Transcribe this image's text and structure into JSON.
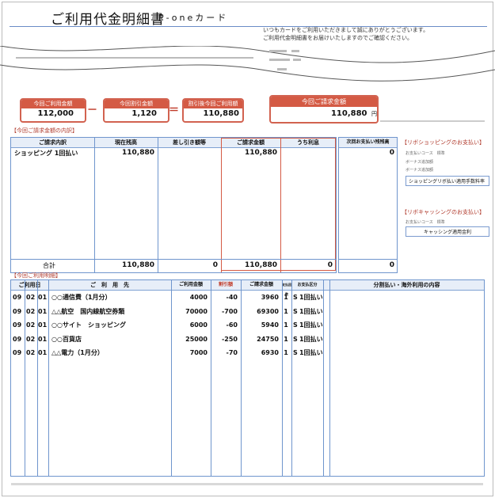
{
  "header": {
    "title": "ご利用代金明細書",
    "card_name": "P‐oneカード",
    "greeting": [
      "いつもカードをご利用いただきまして誠にありがとうございます。",
      "ご利用代金明細書をお届けいたしますのでご確認ください。"
    ]
  },
  "summary": {
    "labels": {
      "current_usage": "今回ご利用金額",
      "current_discount": "今回割引金額",
      "after_discount": "割引後今回ご利用額",
      "billing": "今回ご請求金額"
    },
    "values": {
      "current_usage": "112,000",
      "current_discount": "1,120",
      "after_discount": "110,880",
      "billing": "110,880"
    },
    "units": {
      "yen": "円"
    },
    "operators": {
      "minus": "－",
      "equals": "＝"
    }
  },
  "billing_section": {
    "title": "【今回ご請求金額の内訳】",
    "headers": [
      "ご請求内訳",
      "現在残高",
      "差し引き額等",
      "ご請求金額",
      "うち利息",
      "次回お支払い残残高"
    ],
    "row_label": "ショッピング 1回払い",
    "row_values": {
      "balance": "110,880",
      "billing": "110,880",
      "next": "0"
    },
    "total_label": "合計",
    "totals": {
      "balance": "110,880",
      "deduction": "0",
      "billing": "110,880",
      "interest": "0",
      "next": "0"
    }
  },
  "side": {
    "revo_shopping_title": "【リボショッピングのお支払い】",
    "revo_shopping_lines": [
      "お支払いコース　標準",
      "ボーナス追加額",
      "ボーナス追加額"
    ],
    "revo_shopping_box": "ショッピングリボ払い適用手数料率",
    "revo_cashing_title": "【リボキャッシングのお支払い】",
    "revo_cashing_line": "お支払いコース　標準",
    "revo_cashing_box": "キャッシング適用金利"
  },
  "details": {
    "title": "【今回ご利用明細】",
    "headers": [
      "ご利用日",
      "ご　利　用　先",
      "ご利用金額",
      "割引額",
      "ご請求金額",
      "支払回数",
      "お支払区分",
      "分割払い・海外利用の内容"
    ],
    "rows": [
      {
        "yy": "09",
        "mm": "02",
        "dd": "01",
        "place": "○○通信費（1月分）",
        "amount": "4000",
        "discount": "-40",
        "billing": "3960",
        "count": "1",
        "type": "S",
        "kubun": "1回払い"
      },
      {
        "yy": "09",
        "mm": "02",
        "dd": "01",
        "place": "△△航空　国内線航空券類",
        "amount": "70000",
        "discount": "-700",
        "billing": "69300",
        "count": "1",
        "type": "S",
        "kubun": "1回払い"
      },
      {
        "yy": "09",
        "mm": "02",
        "dd": "01",
        "place": "○○サイト　ショッピング",
        "amount": "6000",
        "discount": "-60",
        "billing": "5940",
        "count": "1",
        "type": "S",
        "kubun": "1回払い"
      },
      {
        "yy": "09",
        "mm": "02",
        "dd": "01",
        "place": "○○百貨店",
        "amount": "25000",
        "discount": "-250",
        "billing": "24750",
        "count": "1",
        "type": "S",
        "kubun": "1回払い"
      },
      {
        "yy": "09",
        "mm": "02",
        "dd": "01",
        "place": "△△電力（1月分）",
        "amount": "7000",
        "discount": "-70",
        "billing": "6930",
        "count": "1",
        "type": "S",
        "kubun": "1回払い"
      }
    ]
  },
  "colors": {
    "accent_red": "#d45a44",
    "line_blue": "#6f95cd"
  }
}
